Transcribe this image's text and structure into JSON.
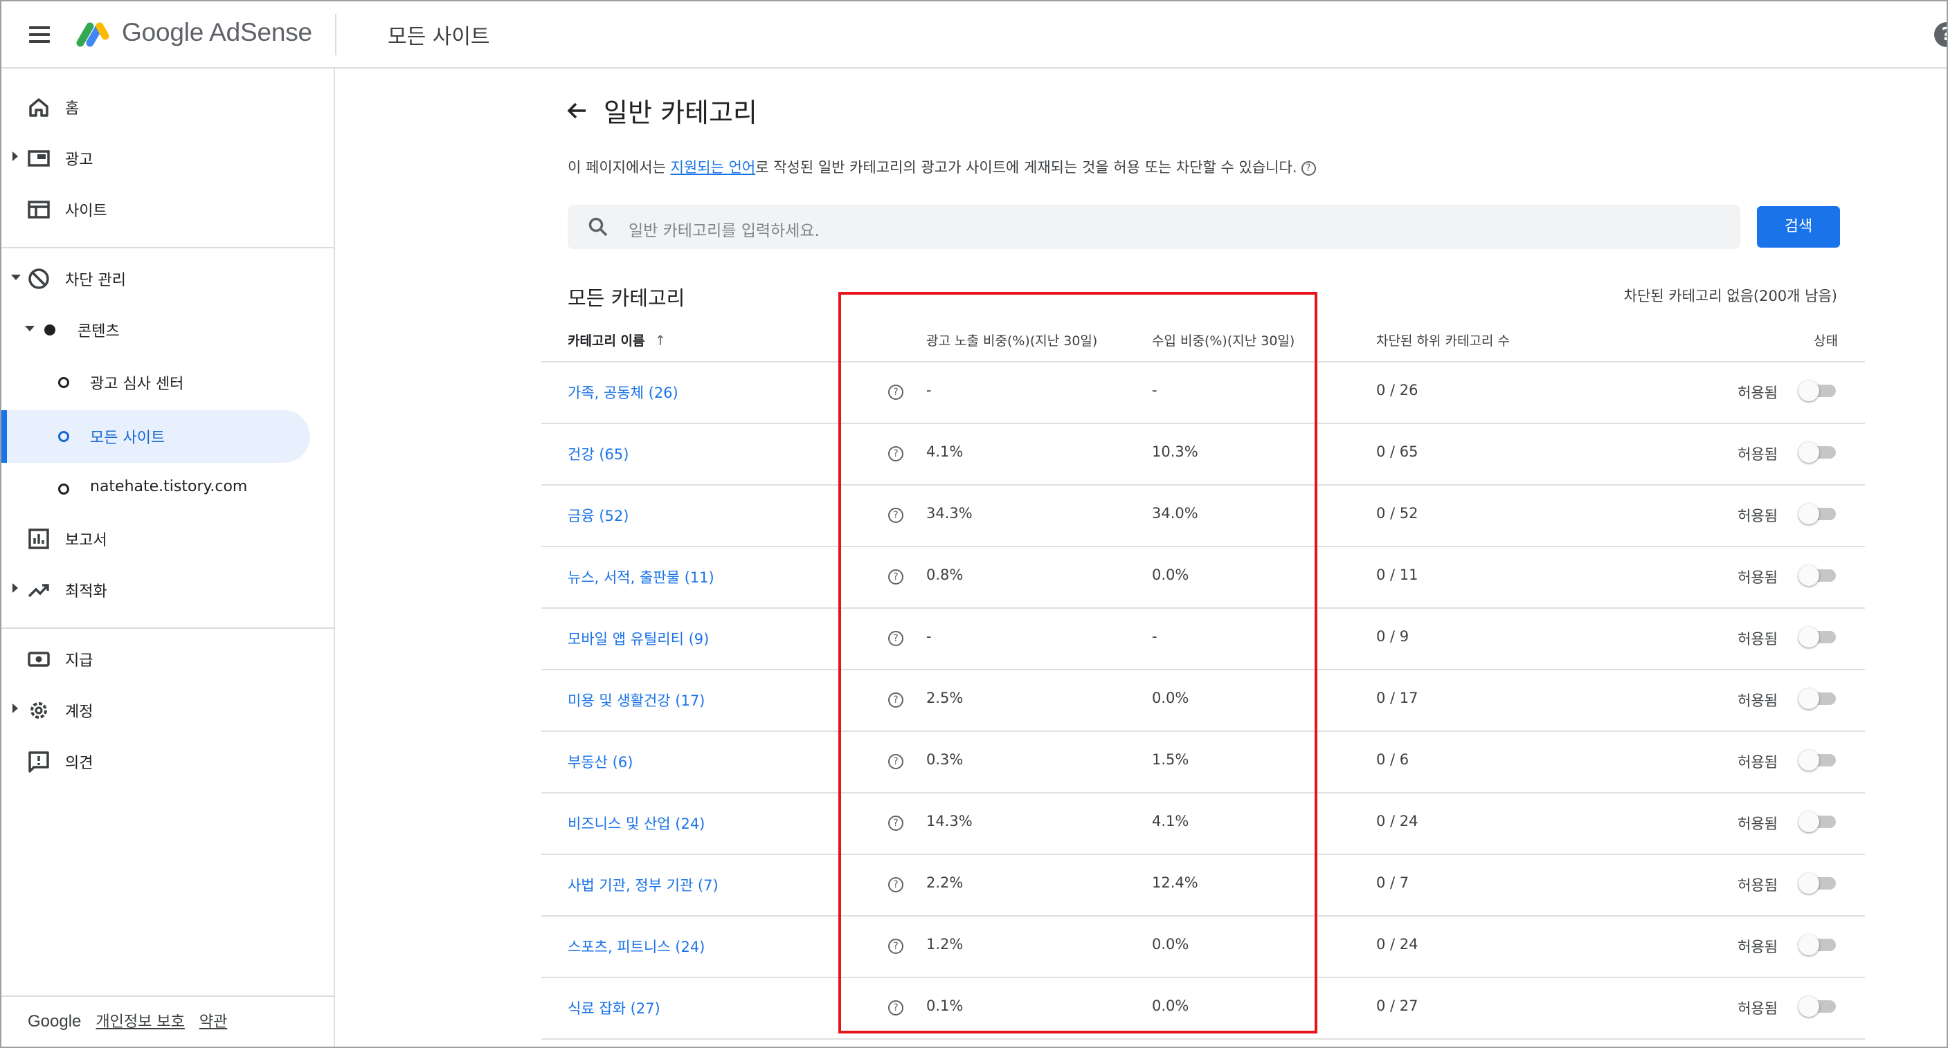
{
  "header": {
    "brand": "Google AdSense",
    "page_name": "모든 사이트",
    "help_icon": "?"
  },
  "sidebar": {
    "items": [
      {
        "label": "홈",
        "icon": "home-icon"
      },
      {
        "label": "광고",
        "icon": "ads-icon"
      },
      {
        "label": "사이트",
        "icon": "sites-icon"
      },
      {
        "label": "차단 관리",
        "icon": "block-icon"
      },
      {
        "label": "콘텐츠",
        "icon": "dot-icon"
      },
      {
        "label": "광고 심사 센터",
        "icon": "ring-icon"
      },
      {
        "label": "모든 사이트",
        "icon": "ring-icon"
      },
      {
        "label": "natehate.tistory.com",
        "icon": "ring-icon"
      },
      {
        "label": "보고서",
        "icon": "report-icon"
      },
      {
        "label": "최적화",
        "icon": "trending-icon"
      },
      {
        "label": "지급",
        "icon": "payments-icon"
      },
      {
        "label": "계정",
        "icon": "gear-icon"
      },
      {
        "label": "의견",
        "icon": "feedback-icon"
      }
    ],
    "footer": {
      "brand": "Google",
      "privacy": "개인정보 보호",
      "terms": "약관"
    }
  },
  "main": {
    "title": "일반 카테고리",
    "intro_before": "이 페이지에서는 ",
    "intro_link": "지원되는 언어",
    "intro_after": "로 작성된 일반 카테고리의 광고가 사이트에 게재되는 것을 허용 또는 차단할 수 있습니다.",
    "intro_help": "?",
    "search_placeholder": "일반 카테고리를 입력하세요.",
    "search_button": "검색",
    "section_title": "모든 카테고리",
    "blocked_summary": "차단된 카테고리 없음(200개 남음)",
    "columns": {
      "name": "카테고리 이름",
      "sort_arrow": "↑",
      "impressions": "광고 노출 비중(%)(지난 30일)",
      "earnings": "수입 비중(%)(지난 30일)",
      "blocked_sub": "차단된 하위 카테고리 수",
      "status": "상태"
    },
    "rows": [
      {
        "name": "가족, 공동체 (26)",
        "impressions": "-",
        "earnings": "-",
        "blocked": "0 / 26",
        "status": "허용됨"
      },
      {
        "name": "건강 (65)",
        "impressions": "4.1%",
        "earnings": "10.3%",
        "blocked": "0 / 65",
        "status": "허용됨"
      },
      {
        "name": "금융 (52)",
        "impressions": "34.3%",
        "earnings": "34.0%",
        "blocked": "0 / 52",
        "status": "허용됨"
      },
      {
        "name": "뉴스, 서적, 출판물 (11)",
        "impressions": "0.8%",
        "earnings": "0.0%",
        "blocked": "0 / 11",
        "status": "허용됨"
      },
      {
        "name": "모바일 앱 유틸리티 (9)",
        "impressions": "-",
        "earnings": "-",
        "blocked": "0 / 9",
        "status": "허용됨"
      },
      {
        "name": "미용 및 생활건강 (17)",
        "impressions": "2.5%",
        "earnings": "0.0%",
        "blocked": "0 / 17",
        "status": "허용됨"
      },
      {
        "name": "부동산 (6)",
        "impressions": "0.3%",
        "earnings": "1.5%",
        "blocked": "0 / 6",
        "status": "허용됨"
      },
      {
        "name": "비즈니스 및 산업 (24)",
        "impressions": "14.3%",
        "earnings": "4.1%",
        "blocked": "0 / 24",
        "status": "허용됨"
      },
      {
        "name": "사법 기관, 정부 기관 (7)",
        "impressions": "2.2%",
        "earnings": "12.4%",
        "blocked": "0 / 7",
        "status": "허용됨"
      },
      {
        "name": "스포츠, 피트니스 (24)",
        "impressions": "1.2%",
        "earnings": "0.0%",
        "blocked": "0 / 24",
        "status": "허용됨"
      },
      {
        "name": "식료 잡화 (27)",
        "impressions": "0.1%",
        "earnings": "0.0%",
        "blocked": "0 / 27",
        "status": "허용됨"
      }
    ]
  },
  "colors": {
    "accent": "#1a73e8",
    "highlight_box": "#e8141b",
    "active_nav_bg": "#e8f0fe"
  }
}
